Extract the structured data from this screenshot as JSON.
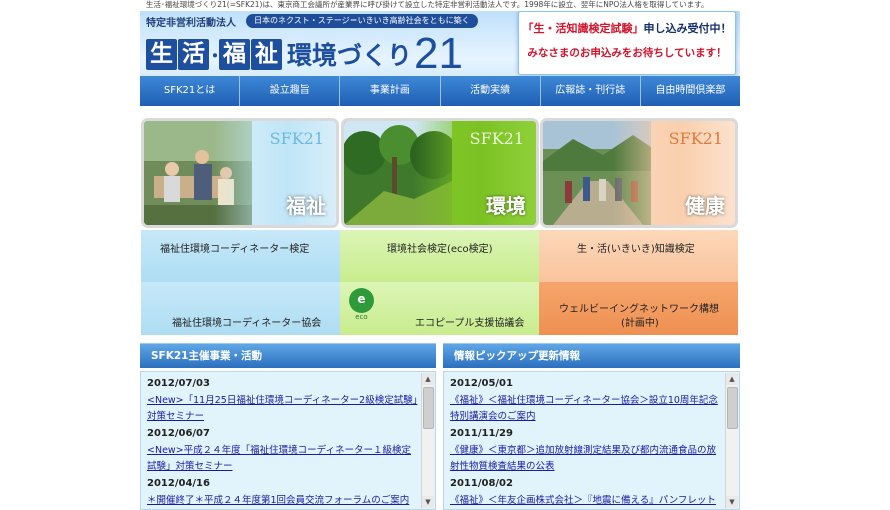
{
  "top_text": "生活･福祉環境づくり21(=SFK21)は、東京商工会議所が産業界に呼び掛けて設立した特定非営利活動法人です。1998年に設立、翌年にNPO法人格を取得しています。",
  "header": {
    "org_type": "特定非営利活動法人",
    "tagline": "日本のネクスト・ステージ＝いきいき高齢社会をともに築く",
    "logo_boxes": [
      "生",
      "活",
      "福",
      "祉"
    ],
    "logo_dot": "･",
    "logo_rest": "環境づくり",
    "logo_num": "21",
    "notice": {
      "exam": "「生・活知識検定試験」",
      "line1_rest": "申し込み受付中！",
      "line2": "みなさまのお申込みをお待ちしています！"
    }
  },
  "nav": [
    "SFK21とは",
    "設立趣旨",
    "事業計画",
    "活動実績",
    "広報誌・刊行誌",
    "自由時間倶楽部"
  ],
  "tiles": [
    {
      "code": "SFK21",
      "label": "福祉"
    },
    {
      "code": "SFK21",
      "label": "環境"
    },
    {
      "code": "SFK21",
      "label": "健康"
    }
  ],
  "programs": {
    "row1": [
      "福祉住環境コーディネーター検定",
      "環境社会検定(eco検定)",
      "生・活(いきいき)知識検定"
    ],
    "row2": [
      "福祉住環境コーディネーター協会",
      "エコピープル支援協議会",
      "ウェルビーイングネットワーク構想",
      "(計画中)"
    ],
    "eco_badge": "e",
    "eco_word": "eco"
  },
  "panels": {
    "left": {
      "title": "SFK21主催事業・活動",
      "entries": [
        {
          "date": "2012/07/03",
          "text": "<New>「11月25日福祉住環境コーディネーター2級検定試験」対策セミナー"
        },
        {
          "date": "2012/06/07",
          "text": "<New>平成２４年度「福祉住環境コーディネーター１級検定試験」対策セミナー"
        },
        {
          "date": "2012/04/16",
          "text": "＊開催終了＊平成２４年度第1回会員交流フォーラムのご案内"
        }
      ]
    },
    "right": {
      "title": "情報ピックアップ更新情報",
      "entries": [
        {
          "date": "2012/05/01",
          "text": "《福祉》＜福祉住環境コーディネーター協会＞設立10周年記念特別講演会のご案内"
        },
        {
          "date": "2011/11/29",
          "text": "《健康》＜東京都＞追加放射線測定結果及び都内流通食品の放射性物質検査結果の公表"
        },
        {
          "date": "2011/08/02",
          "text": "《福祉》＜年友企画株式会社＞『地震に備える』パンフレットのご"
        }
      ]
    }
  },
  "scroll_icons": {
    "up": "▲",
    "down": "▼"
  },
  "colors": {
    "brand_blue": "#1e4f9e",
    "nav_blue": "#2e74c6",
    "notice_red": "#d0142c",
    "link": "#1a1aa6"
  }
}
